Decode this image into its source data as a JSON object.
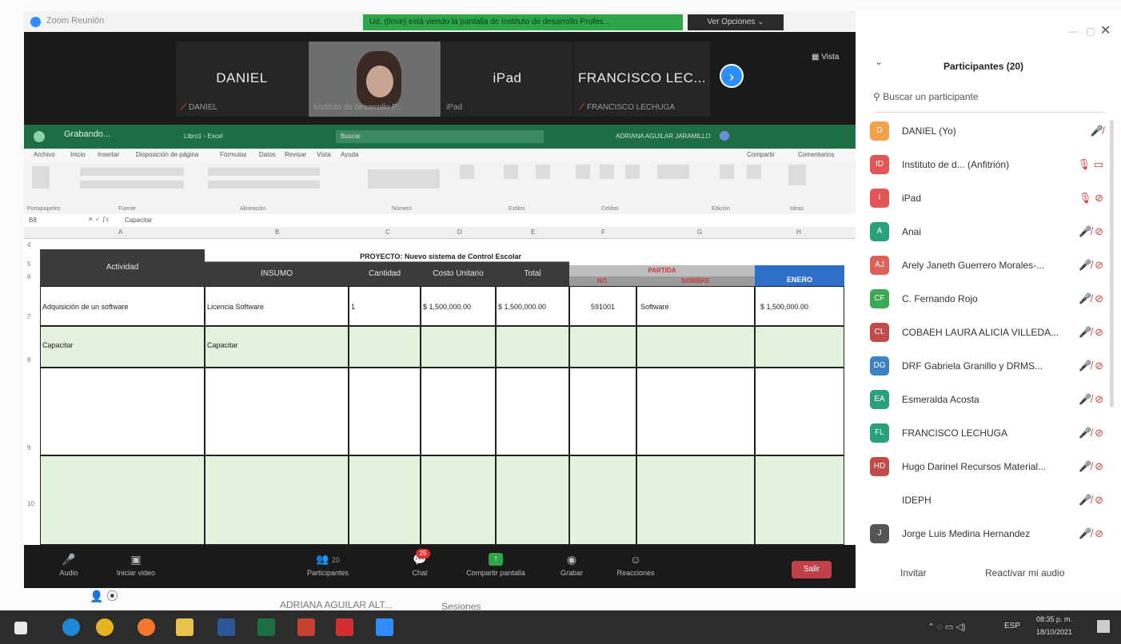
{
  "zoom": {
    "window_title": "Zoom Reunión",
    "share_banner": "Ud. (tlove) está viendo la pantalla de Instituto de desarrollo Profes...",
    "view_options": "Ver Opciones ⌄",
    "view_button": "Vista",
    "gallery": [
      {
        "name": "DANIEL",
        "label": "DANIEL",
        "muted": true
      },
      {
        "name": "",
        "label": "Instituto de desarrollo P...",
        "muted": false,
        "video": true
      },
      {
        "name": "iPad",
        "label": "iPad",
        "muted": false
      },
      {
        "name": "FRANCISCO LEC...",
        "label": "FRANCISCO LECHUGA",
        "muted": true
      }
    ],
    "toolbar": {
      "audio": "Audio",
      "video": "Iniciar video",
      "participants": "Participantes",
      "participants_count": "20",
      "chat": "Chat",
      "chat_badge": "25",
      "share": "Compartir pantalla",
      "record": "Grabar",
      "reactions": "Reacciones",
      "leave": "Salir"
    }
  },
  "excel": {
    "recording": "Grabando...",
    "doc_title": "Libro1 - Excel",
    "search": "Buscar",
    "user": "ADRIANA AGUILAR JARAMILLO",
    "menu": [
      "Archivo",
      "Inicio",
      "Insertar",
      "Disposición de página",
      "Fórmulas",
      "Datos",
      "Revisar",
      "Vista",
      "Ayuda"
    ],
    "share": "Compartir",
    "comments": "Comentarios",
    "ribbon_groups": [
      "Portapapeles",
      "Fuente",
      "Alineación",
      "Número",
      "Estilos",
      "Celdas",
      "Edición",
      "Ideas"
    ],
    "name_box": "B8",
    "formula": "Capacitar",
    "columns": [
      "A",
      "B",
      "C",
      "D",
      "E",
      "F",
      "G",
      "H"
    ],
    "rows": [
      "4",
      "5",
      "6",
      "7",
      "8",
      "9",
      "10"
    ],
    "project_label": "PROYECTO:",
    "project_name": "Nuevo sistema de Control Escolar",
    "headers": {
      "actividad": "Actividad",
      "insumo": "INSUMO",
      "cantidad": "Cantidad",
      "costo": "Costo Unitario",
      "total": "Total",
      "partida": "PARTIDA",
      "no": "NO.",
      "nombre": "NOMBRE",
      "enero": "ENERO"
    },
    "row7": {
      "actividad": "Adquisición de un software",
      "insumo": "Licencia Software",
      "cantidad": "1",
      "costo": "$ 1,500,000.00",
      "total": "$ 1,500,000.00",
      "no": "591001",
      "nombre": "Software",
      "enero": "$ 1,500,000.00"
    },
    "row8": {
      "actividad": "Capacitar",
      "insumo": "Capacitar"
    }
  },
  "participants": {
    "title": "Participantes (20)",
    "search_placeholder": "Buscar un participante",
    "list": [
      {
        "initials": "D",
        "color": "#f0a14a",
        "name": "DANIEL (Yo)",
        "icons": "🎤̸"
      },
      {
        "initials": "ID",
        "color": "#e25555",
        "name": "Instituto de d... (Anfitrión)",
        "icons": "🎙 ▭"
      },
      {
        "initials": "I",
        "color": "#e25555",
        "name": "iPad",
        "icons": "🎙 ⊘"
      },
      {
        "initials": "A",
        "color": "#2aa07b",
        "name": "Anai",
        "icons": "🎤̸ ⊘"
      },
      {
        "initials": "AJ",
        "color": "#e0605a",
        "name": "Arely Janeth Guerrero Morales-...",
        "icons": "🎤̸ ⊘"
      },
      {
        "initials": "CF",
        "color": "#3aaa55",
        "name": "C. Fernando Rojo",
        "icons": "🎤̸ ⊘"
      },
      {
        "initials": "CL",
        "color": "#c14a4a",
        "name": "COBAEH LAURA ALICIA VILLEDA...",
        "icons": "🎤̸ ⊘"
      },
      {
        "initials": "DG",
        "color": "#3b82c4",
        "name": "DRF Gabriela Granillo y DRMS...",
        "icons": "🎤̸ ⊘"
      },
      {
        "initials": "EA",
        "color": "#2aa07b",
        "name": "Esmeralda Acosta",
        "icons": "🎤̸ ⊘"
      },
      {
        "initials": "FL",
        "color": "#2aa07b",
        "name": "FRANCISCO LECHUGA",
        "icons": "🎤̸ ⊘"
      },
      {
        "initials": "HD",
        "color": "#c14a4a",
        "name": "Hugo Darinel Recursos Material...",
        "icons": "🎤̸ ⊘"
      },
      {
        "initials": "",
        "color": "#ffffff",
        "name": "IDEPH",
        "icons": "🎤̸ ⊘"
      },
      {
        "initials": "J",
        "color": "#555555",
        "name": "Jorge Luis Medina Hernandez",
        "icons": "🎤̸ ⊘"
      }
    ],
    "invite": "Invitar",
    "unmute": "Reactivar mi audio"
  },
  "behind": {
    "name": "ADRIANA AGUILAR ALT...",
    "sessions": "Sesiones"
  },
  "taskbar": {
    "lang": "ESP",
    "time": "08:35 p. m.",
    "date": "18/10/2021"
  }
}
